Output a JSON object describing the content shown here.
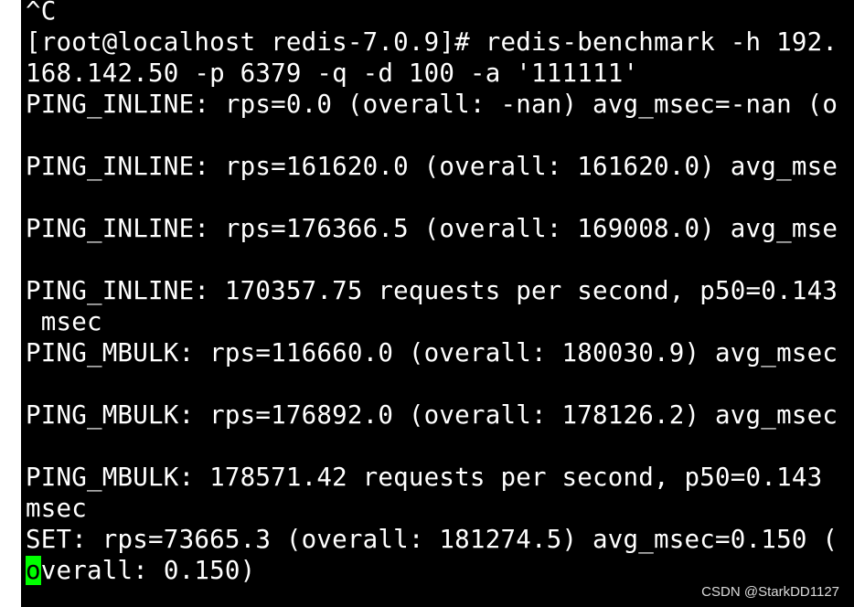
{
  "terminal": {
    "background": "#000000",
    "foreground": "#ffffff",
    "cursor_color": "#00ff00",
    "lines": [
      "^C",
      "[root@localhost redis-7.0.9]# redis-benchmark -h 192.",
      "168.142.50 -p 6379 -q -d 100 -a '111111'",
      "PING_INLINE: rps=0.0 (overall: -nan) avg_msec=-nan (o",
      "",
      "PING_INLINE: rps=161620.0 (overall: 161620.0) avg_mse",
      "",
      "PING_INLINE: rps=176366.5 (overall: 169008.0) avg_mse",
      "",
      "PING_INLINE: 170357.75 requests per second, p50=0.143",
      " msec",
      "PING_MBULK: rps=116660.0 (overall: 180030.9) avg_msec",
      "",
      "PING_MBULK: rps=176892.0 (overall: 178126.2) avg_msec",
      "",
      "PING_MBULK: 178571.42 requests per second, p50=0.143",
      "msec",
      "SET: rps=73665.3 (overall: 181274.5) avg_msec=0.150 ("
    ],
    "last_line_cursor_char": "o",
    "last_line_rest": "verall: 0.150)"
  },
  "watermark": "CSDN @StarkDD1127"
}
